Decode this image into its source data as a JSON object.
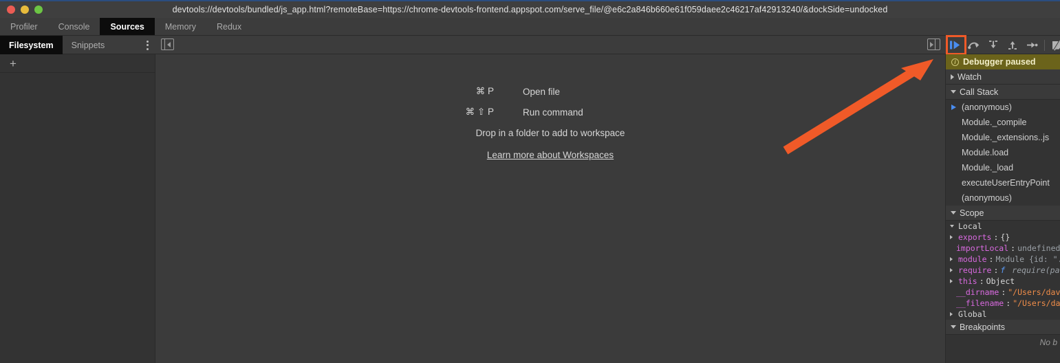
{
  "window": {
    "title": "devtools://devtools/bundled/js_app.html?remoteBase=https://chrome-devtools-frontend.appspot.com/serve_file/@e6c2a846b660e61f059daee2c46217af42913240/&dockSide=undocked",
    "traffic_lights": [
      "close-button",
      "minimize-button",
      "maximize-button"
    ]
  },
  "main_tabs": [
    {
      "label": "Profiler",
      "active": false
    },
    {
      "label": "Console",
      "active": false
    },
    {
      "label": "Sources",
      "active": true
    },
    {
      "label": "Memory",
      "active": false
    },
    {
      "label": "Redux",
      "active": false
    }
  ],
  "navigator": {
    "tabs": [
      {
        "label": "Filesystem",
        "active": true
      },
      {
        "label": "Snippets",
        "active": false
      }
    ],
    "more_options": "⋮",
    "add_folder": "+"
  },
  "editor_placeholder": {
    "rows": [
      {
        "keys": "⌘ P",
        "label": "Open file"
      },
      {
        "keys": "⌘ ⇧ P",
        "label": "Run command"
      }
    ],
    "drop_hint": "Drop in a folder to add to workspace",
    "link": "Learn more about Workspaces"
  },
  "debug_toolbar": {
    "buttons": [
      {
        "name": "resume-script-execution",
        "highlighted": true
      },
      {
        "name": "step-over-next-function-call",
        "highlighted": false
      },
      {
        "name": "step-into-next-function-call",
        "highlighted": false
      },
      {
        "name": "step-out-of-current-function",
        "highlighted": false
      },
      {
        "name": "step",
        "highlighted": false
      },
      {
        "name": "deactivate-breakpoints",
        "highlighted": false
      }
    ]
  },
  "sidebar": {
    "paused_banner": "Debugger paused",
    "sections": {
      "watch": {
        "label": "Watch",
        "expanded": false
      },
      "call_stack": {
        "label": "Call Stack",
        "expanded": true
      },
      "scope": {
        "label": "Scope",
        "expanded": true
      },
      "breakpoints": {
        "label": "Breakpoints",
        "expanded": true
      }
    },
    "call_stack": [
      {
        "label": "(anonymous)",
        "selected": true
      },
      {
        "label": "Module._compile",
        "selected": false
      },
      {
        "label": "Module._extensions..js",
        "selected": false
      },
      {
        "label": "Module.load",
        "selected": false
      },
      {
        "label": "Module._load",
        "selected": false
      },
      {
        "label": "executeUserEntryPoint",
        "selected": false
      },
      {
        "label": "(anonymous)",
        "selected": false
      }
    ],
    "scope": {
      "local_label": "Local",
      "global_label": "Global",
      "entries": [
        {
          "expandable": true,
          "prop": "exports",
          "sep": ": ",
          "value": "{}",
          "kind": "val"
        },
        {
          "expandable": false,
          "prop": "importLocal",
          "sep": ": ",
          "value": "undefined",
          "kind": "val"
        },
        {
          "expandable": true,
          "prop": "module",
          "sep": ": ",
          "value": "Module {id: \".",
          "kind": "val"
        },
        {
          "expandable": true,
          "prop": "require",
          "sep": ": ",
          "value": "require(pat",
          "kind": "fn"
        },
        {
          "expandable": true,
          "prop": "this",
          "sep": ": ",
          "value": "Object",
          "kind": "name"
        },
        {
          "expandable": false,
          "prop": "__dirname",
          "sep": ": ",
          "value": "\"/Users/dav",
          "kind": "str"
        },
        {
          "expandable": false,
          "prop": "__filename",
          "sep": ": ",
          "value": "\"/Users/da",
          "kind": "str"
        }
      ]
    },
    "breakpoints_empty": "No b"
  },
  "annotation": {
    "arrow_color": "#f05a28",
    "highlight_color": "#f05a28"
  }
}
